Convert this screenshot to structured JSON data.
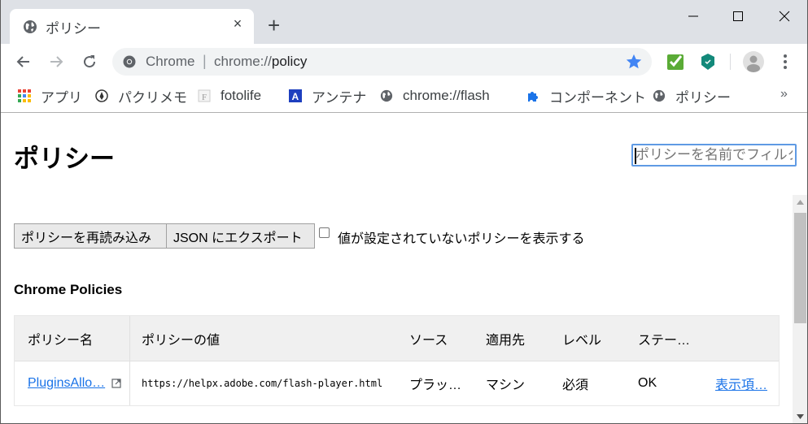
{
  "browser": {
    "tab": {
      "title": "ポリシー",
      "icon": "globe-icon",
      "close_label": "×"
    },
    "new_tab_label": "+",
    "window_controls": {
      "minimize": "minimize-icon",
      "maximize": "maximize-icon",
      "close": "close-icon"
    },
    "toolbar": {
      "back": "back-arrow-icon",
      "forward": "forward-arrow-icon",
      "reload": "reload-icon",
      "omnibox": {
        "chip": "Chrome",
        "separator": "|",
        "url_scheme": "chrome://",
        "url_host": "policy"
      },
      "bookmark_star_color": "#4285f4",
      "extensions": [
        "checkmark-extension-icon",
        "shield-extension-icon"
      ]
    },
    "bookmarks": [
      {
        "label": "アプリ",
        "icon": "apps-grid-icon"
      },
      {
        "label": "パクリメモ",
        "icon": "pen-circle-icon"
      },
      {
        "label": "fotolife",
        "icon": "fotolife-icon"
      },
      {
        "label": "アンテナ",
        "icon": "antenna-a-icon"
      },
      {
        "label": "chrome://flash",
        "icon": "globe-icon"
      },
      {
        "label": "コンポーネント",
        "icon": "puzzle-icon"
      },
      {
        "label": "ポリシー",
        "icon": "globe-icon"
      }
    ],
    "bookmarks_overflow": "»"
  },
  "page": {
    "title": "ポリシー",
    "filter": {
      "placeholder": "ポリシーを名前でフィルタ",
      "value": ""
    },
    "buttons": {
      "reload": "ポリシーを再読み込み",
      "export": "JSON にエクスポート"
    },
    "show_unset": {
      "label": "値が設定されていないポリシーを表示する",
      "checked": false
    },
    "section_title": "Chrome Policies",
    "table": {
      "headers": [
        "ポリシー名",
        "ポリシーの値",
        "ソース",
        "適用先",
        "レベル",
        "ステー…"
      ],
      "rows": [
        {
          "name": "PluginsAllo…",
          "value": "https://helpx.adobe.com/flash-player.html",
          "source": "プラッ…",
          "scope": "マシン",
          "level": "必須",
          "status": "OK",
          "more": "表示項…"
        }
      ]
    }
  },
  "colors": {
    "link": "#1a73e8",
    "tabstrip": "#dee1e6",
    "header_bg": "#f0f0f0",
    "focus_border": "#5f9ae4"
  }
}
